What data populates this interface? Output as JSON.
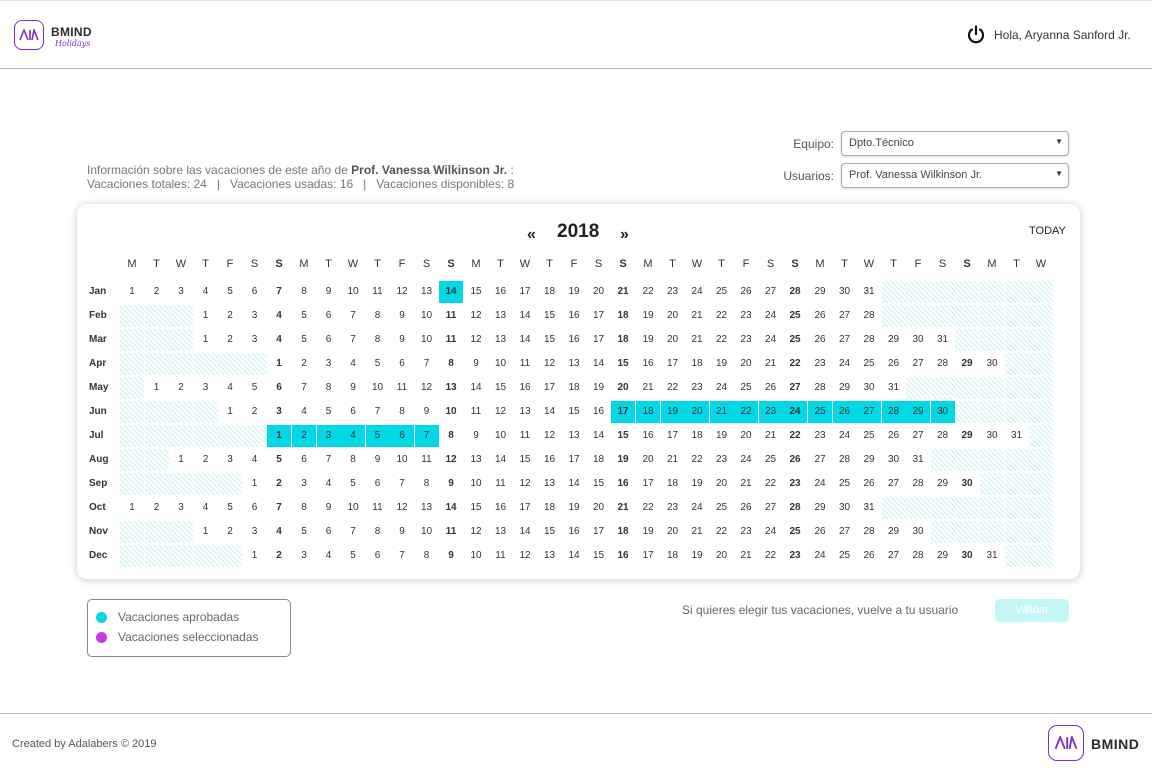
{
  "header": {
    "brand": "BMIND",
    "brand_sub": "Holidays",
    "greeting": "Hola, Aryanna Sanford Jr."
  },
  "filters": {
    "team_label": "Equipo:",
    "team_value": "Dpto.Técnico",
    "users_label": "Usuarios:",
    "users_value": "Prof. Vanessa Wilkinson Jr."
  },
  "info": {
    "line1_prefix": "Información sobre las vacaciones de este año de",
    "name": "Prof. Vanessa Wilkinson Jr.",
    "line1_suffix": ":",
    "line2": "Vacaciones totales: 24   |   Vacaciones usadas: 16   |   Vacaciones disponibles: 8"
  },
  "calendar": {
    "prev": "«",
    "year": "2018",
    "next": "»",
    "today": "TODAY",
    "weekday_headers": [
      "M",
      "T",
      "W",
      "T",
      "F",
      "S",
      "S"
    ],
    "months": [
      {
        "label": "Jan",
        "offset": 0,
        "days": 31
      },
      {
        "label": "Feb",
        "offset": 3,
        "days": 28
      },
      {
        "label": "Mar",
        "offset": 3,
        "days": 31
      },
      {
        "label": "Apr",
        "offset": 6,
        "days": 30
      },
      {
        "label": "May",
        "offset": 1,
        "days": 31
      },
      {
        "label": "Jun",
        "offset": 4,
        "days": 30
      },
      {
        "label": "Jul",
        "offset": 6,
        "days": 31
      },
      {
        "label": "Aug",
        "offset": 2,
        "days": 31
      },
      {
        "label": "Sep",
        "offset": 5,
        "days": 30
      },
      {
        "label": "Oct",
        "offset": 0,
        "days": 31
      },
      {
        "label": "Nov",
        "offset": 3,
        "days": 30
      },
      {
        "label": "Dec",
        "offset": 5,
        "days": 31
      }
    ],
    "approved": {
      "Jan": [
        14
      ],
      "Jun": [
        17,
        18,
        19,
        20,
        21,
        22,
        23,
        24,
        25,
        26,
        27,
        28,
        29,
        30
      ],
      "Jul": [
        1,
        2,
        3,
        4,
        5,
        6,
        7
      ]
    },
    "colors": {
      "approved": "#00d8e6",
      "selected": "#c837e0"
    }
  },
  "legend": {
    "approved": "Vacaciones aprobadas",
    "selected": "Vacaciones seleccionadas"
  },
  "actions": {
    "hint": "Si quieres elegir tus vacaciones, vuelve a tu usuario",
    "validate": "Validar"
  },
  "footer": {
    "credit": "Created by Adalabers © 2019",
    "brand": "BMIND"
  }
}
